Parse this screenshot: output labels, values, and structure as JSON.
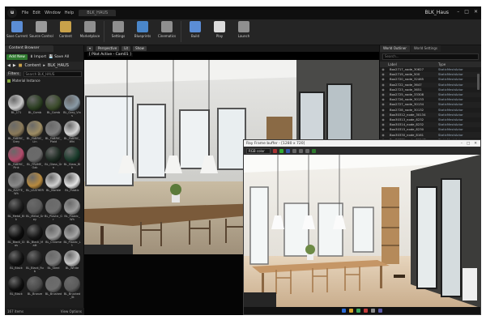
{
  "window": {
    "logo": "u",
    "menu": [
      "File",
      "Edit",
      "Window",
      "Help"
    ],
    "project_tab": "BLK_HAUS",
    "project_name": "BLK_Haus",
    "controls": [
      "minimize-icon",
      "maximize-icon",
      "close-icon"
    ]
  },
  "toolbar": {
    "buttons": [
      {
        "label": "Save Current",
        "icon": "save-icon",
        "color": "#5b8dd6"
      },
      {
        "label": "Source Control",
        "icon": "source-control-icon",
        "color": "#9a9a9a"
      },
      {
        "label": "Content",
        "icon": "content-icon",
        "color": "#c9a24a"
      },
      {
        "label": "Marketplace",
        "icon": "marketplace-icon",
        "color": "#8f8f8f"
      },
      {
        "label": "Settings",
        "icon": "gear-icon",
        "color": "#8f8f8f"
      },
      {
        "label": "Blueprints",
        "icon": "blueprint-icon",
        "color": "#4a86c9"
      },
      {
        "label": "Cinematics",
        "icon": "clapper-icon",
        "color": "#8f8f8f"
      },
      {
        "label": "Build",
        "icon": "build-icon",
        "color": "#5b8dd6"
      },
      {
        "label": "Play",
        "icon": "play-icon",
        "color": "#dcdcdc"
      },
      {
        "label": "Launch",
        "icon": "launch-icon",
        "color": "#8f8f8f"
      }
    ]
  },
  "content_browser": {
    "tab": "Content Browser",
    "add_new": "Add New",
    "import": "Import",
    "save_all": "Save All",
    "path_root": "Content",
    "path_folder": "BLK_HAUS",
    "filters": "Filters",
    "search_placeholder": "Search BLK_HAUS",
    "filter_tag": "Material Instance",
    "assets": [
      {
        "name": "BL_171",
        "color": "#c9c9c9"
      },
      {
        "name": "BL_Comb",
        "color": "#2c3f22"
      },
      {
        "name": "BL_Comb",
        "color": "#3a4a2a"
      },
      {
        "name": "BL_Grey_Vins",
        "color": "#8a9aa6"
      },
      {
        "name": "BL_FABRIC_Grey",
        "color": "#8a7a5a"
      },
      {
        "name": "BL_FABRIC_Lin",
        "color": "#9d8c63"
      },
      {
        "name": "BL_FABRIC_Plaid",
        "color": "#7f7f7f"
      },
      {
        "name": "BL_FABRIC_Whi",
        "color": "#d4d4d4"
      },
      {
        "name": "BL_FABRIC_Pink",
        "color": "#b04a6a"
      },
      {
        "name": "BL_FRAME_Oak",
        "color": "#6a6a6a"
      },
      {
        "name": "BL_Glass_Grn",
        "color": "#1d2b22"
      },
      {
        "name": "BL_Glass_Blk",
        "color": "#1a3b2b"
      },
      {
        "name": "BL_MATTE_Wh",
        "color": "#8a8a8a"
      },
      {
        "name": "BL_LEATHER",
        "color": "#b78a3f"
      },
      {
        "name": "BL_Marble",
        "color": "#cfcfcf"
      },
      {
        "name": "BL_Plastic",
        "color": "#e2e2e2"
      },
      {
        "name": "BL_Metal_Blk",
        "color": "#1a1a1a"
      },
      {
        "name": "BL_Metal_Grey",
        "color": "#5a5a5a"
      },
      {
        "name": "BL_Plastic_Gr",
        "color": "#6e6e6e"
      },
      {
        "name": "BL_Plastic_Wh",
        "color": "#9a9a9a"
      },
      {
        "name": "BL_Black_Glos",
        "color": "#0d0d0d"
      },
      {
        "name": "BL_Black_Matt",
        "color": "#161616"
      },
      {
        "name": "BL_Chrome",
        "color": "#9c9c9c"
      },
      {
        "name": "BL_Plastic_Lt",
        "color": "#a5a5a5"
      },
      {
        "name": "BL_Black",
        "color": "#121212"
      },
      {
        "name": "BL_Black_Rub",
        "color": "#232323"
      },
      {
        "name": "BL_Steel",
        "color": "#7d7d7d"
      },
      {
        "name": "BL_White",
        "color": "#c6c6c6"
      },
      {
        "name": "BL_Black",
        "color": "#0f0f0f"
      },
      {
        "name": "BL_Bronze",
        "color": "#4a4a4a"
      },
      {
        "name": "BL_Brushed",
        "color": "#6d6d6d"
      },
      {
        "name": "BL_Brushed_St",
        "color": "#5c5c5c"
      }
    ],
    "item_count": "167 items",
    "view_options": "View Options"
  },
  "viewport": {
    "perspective": "Perspective",
    "lit": "Lit",
    "show": "Show",
    "pilot": "[ Pilot Active - Cam01 ]"
  },
  "outliner": {
    "tabs": [
      "World Outliner",
      "World Settings"
    ],
    "search_placeholder": "Search...",
    "col_label": "Label",
    "col_type": "Type",
    "rows": [
      {
        "name": "Box2717_node_30627",
        "type": "StaticMeshActor"
      },
      {
        "name": "Box2719_node_500",
        "type": "StaticMeshActor"
      },
      {
        "name": "Box2720_node_32465",
        "type": "StaticMeshActor"
      },
      {
        "name": "Box2722_node_3647",
        "type": "StaticMeshActor"
      },
      {
        "name": "Box2723_node_3651",
        "type": "StaticMeshActor"
      },
      {
        "name": "Box2725_node_33308",
        "type": "StaticMeshActor"
      },
      {
        "name": "Box2726_node_30133",
        "type": "StaticMeshActor"
      },
      {
        "name": "Box2727_node_30134",
        "type": "StaticMeshActor"
      },
      {
        "name": "Box2728_node_30132",
        "type": "StaticMeshActor"
      },
      {
        "name": "Box30312_node_30134",
        "type": "StaticMeshActor"
      },
      {
        "name": "Box30313_node_8232",
        "type": "StaticMeshActor"
      },
      {
        "name": "Box30314_node_8232",
        "type": "StaticMeshActor"
      },
      {
        "name": "Box30315_node_8230",
        "type": "StaticMeshActor"
      },
      {
        "name": "Box30330_node_8161",
        "type": "StaticMeshActor"
      },
      {
        "name": "Box30331_node_30147",
        "type": "StaticMeshActor"
      }
    ]
  },
  "ray_window": {
    "title": "Ray Frame buffer - [1280 x 720]",
    "channel": "RGB color",
    "controls": [
      "minimize-icon",
      "maximize-icon",
      "close-icon"
    ]
  },
  "colors": {
    "accent": "#2f7a2f",
    "ui_bg": "#1e1e1e"
  }
}
